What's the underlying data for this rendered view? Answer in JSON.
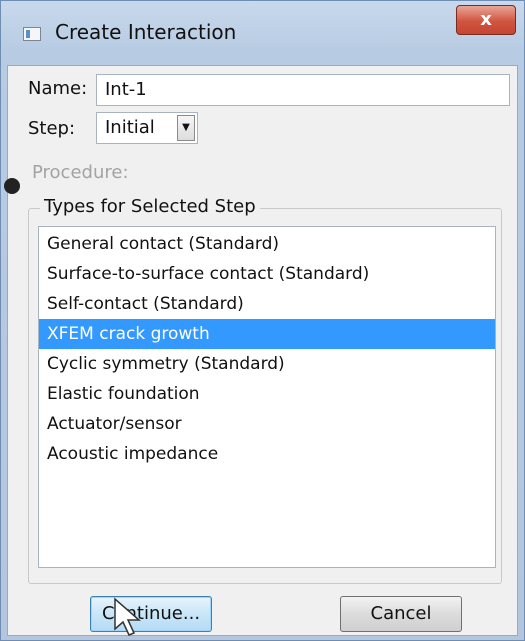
{
  "window": {
    "title": "Create Interaction",
    "close_glyph": "x"
  },
  "form": {
    "name_label": "Name:",
    "name_value": "Int-1",
    "step_label": "Step:",
    "step_value": "Initial",
    "procedure_label": "Procedure:"
  },
  "types_group": {
    "title": "Types for Selected Step",
    "items": [
      {
        "label": "General contact (Standard)",
        "selected": false
      },
      {
        "label": "Surface-to-surface contact (Standard)",
        "selected": false
      },
      {
        "label": "Self-contact (Standard)",
        "selected": false
      },
      {
        "label": "XFEM crack growth",
        "selected": true
      },
      {
        "label": "Cyclic symmetry (Standard)",
        "selected": false
      },
      {
        "label": "Elastic foundation",
        "selected": false
      },
      {
        "label": "Actuator/sensor",
        "selected": false
      },
      {
        "label": "Acoustic impedance",
        "selected": false
      }
    ]
  },
  "buttons": {
    "continue_label": "Continue...",
    "cancel_label": "Cancel"
  },
  "colors": {
    "selection": "#3399ff",
    "close_button": "#c54532",
    "disabled_text": "#a3a3a3"
  }
}
